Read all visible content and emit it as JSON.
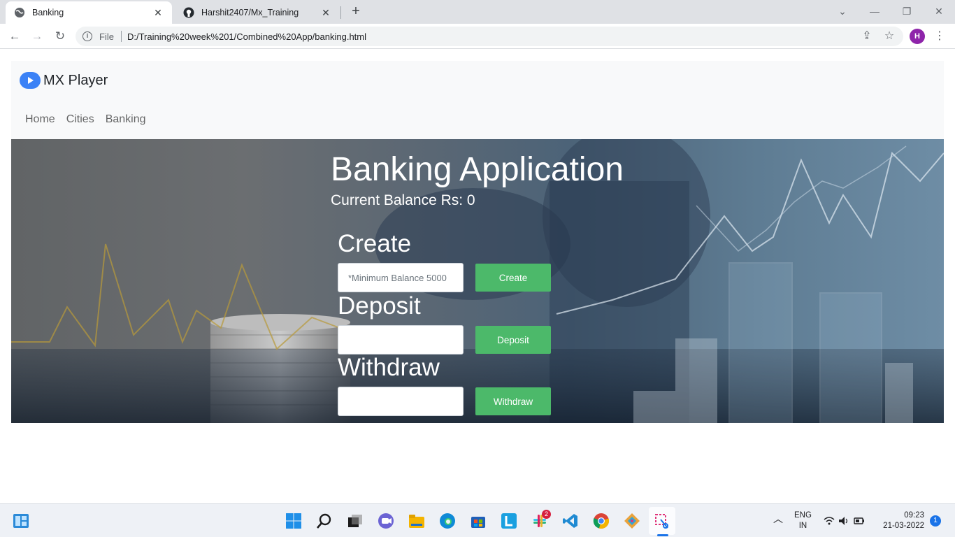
{
  "browser": {
    "tabs": [
      {
        "title": "Banking",
        "active": true
      },
      {
        "title": "Harshit2407/Mx_Training",
        "active": false
      }
    ],
    "scheme_label": "File",
    "url": "D:/Training%20week%201/Combined%20App/banking.html",
    "profile_initial": "H"
  },
  "navbar": {
    "brand": "MX Player",
    "links": [
      "Home",
      "Cities",
      "Banking"
    ]
  },
  "hero": {
    "title": "Banking Application",
    "balance": "Current Balance Rs: 0",
    "create": {
      "heading": "Create",
      "placeholder": "*Minimum Balance 5000",
      "value": "",
      "button": "Create"
    },
    "deposit": {
      "heading": "Deposit",
      "placeholder": "",
      "value": "",
      "button": "Deposit"
    },
    "withdraw": {
      "heading": "Withdraw",
      "placeholder": "",
      "value": "",
      "button": "Withdraw"
    }
  },
  "taskbar": {
    "lang_top": "ENG",
    "lang_bottom": "IN",
    "time": "09:23",
    "date": "21-03-2022",
    "notification_count": "1",
    "slack_badge": "2"
  },
  "colors": {
    "button_green": "#4cb96a",
    "navbar_bg": "#f8f9fa",
    "profile": "#8e24aa"
  }
}
